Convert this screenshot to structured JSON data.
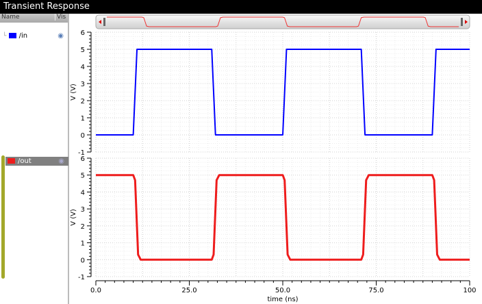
{
  "window": {
    "title": "Transient Response"
  },
  "panel": {
    "name_header": "Name",
    "vis_header": "Vis",
    "signals": [
      {
        "label": "/in",
        "color": "#0000ff",
        "visible_icon": "eye-icon",
        "selected": false
      },
      {
        "label": "/out",
        "color": "#ee1c1c",
        "visible_icon": "eye-icon",
        "selected": true
      }
    ]
  },
  "chart_data": [
    {
      "type": "line",
      "xlabel": "time (ns)",
      "ylabel": "V (V)",
      "xlim": [
        0,
        100
      ],
      "ylim": [
        -1,
        6
      ],
      "yticks": [
        "6",
        "5",
        "4",
        "3",
        "2",
        "1",
        "0",
        "-1"
      ],
      "grid": true,
      "series": [
        {
          "name": "/in",
          "color": "#0000ff",
          "x": [
            0,
            10,
            11,
            31,
            32,
            50,
            51,
            71,
            72,
            90,
            91,
            100
          ],
          "y": [
            0,
            0,
            5,
            5,
            0,
            0,
            5,
            5,
            0,
            0,
            5,
            5
          ]
        }
      ]
    },
    {
      "type": "line",
      "xlabel": "time (ns)",
      "ylabel": "V (V)",
      "xlim": [
        0,
        100
      ],
      "ylim": [
        -1,
        6
      ],
      "yticks": [
        "6",
        "5",
        "4",
        "3",
        "2",
        "1",
        "0",
        "-1"
      ],
      "xticks": [
        "0.0",
        "25.0",
        "50.0",
        "75.0",
        "100"
      ],
      "grid": true,
      "series": [
        {
          "name": "/out",
          "color": "#ee1c1c",
          "x": [
            0,
            10,
            10.5,
            11.3,
            12,
            31,
            31.5,
            32.3,
            33,
            50,
            50.5,
            51.3,
            52,
            71,
            71.5,
            72.3,
            73,
            90,
            90.5,
            91.3,
            92,
            100
          ],
          "y": [
            5,
            5,
            4.7,
            0.3,
            0,
            0,
            0.3,
            4.7,
            5,
            5,
            4.7,
            0.3,
            0,
            0,
            0.3,
            4.7,
            5,
            5,
            4.7,
            0.3,
            0,
            0
          ]
        }
      ]
    }
  ]
}
